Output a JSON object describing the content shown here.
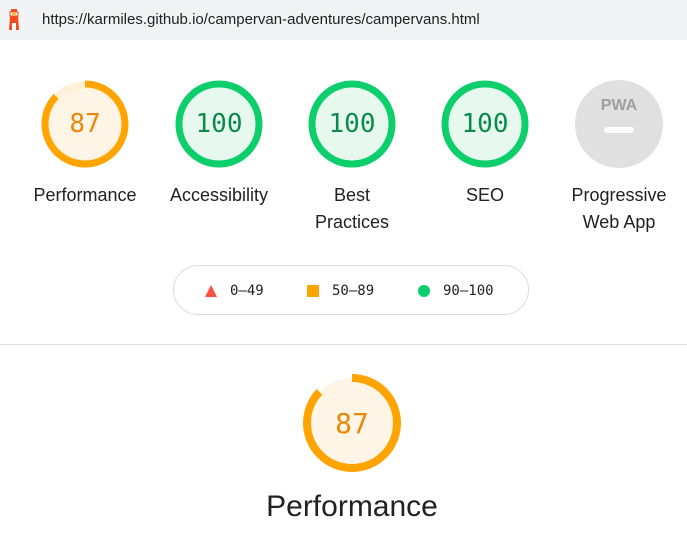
{
  "browser": {
    "url": "https://karmiles.github.io/campervan-adventures/campervans.html",
    "icon": "lighthouse-icon"
  },
  "gauges": [
    {
      "label": "Performance",
      "score": "87",
      "value": 87,
      "status": "average"
    },
    {
      "label": "Accessibility",
      "score": "100",
      "value": 100,
      "status": "pass"
    },
    {
      "label": "Best Practices",
      "score": "100",
      "value": 100,
      "status": "pass"
    },
    {
      "label": "SEO",
      "score": "100",
      "value": 100,
      "status": "pass"
    },
    {
      "label": "Progressive Web App",
      "badge": "PWA",
      "status": "na"
    }
  ],
  "legend": {
    "fail": "0–49",
    "average": "50–89",
    "pass": "90–100"
  },
  "section": {
    "title": "Performance",
    "score": "87",
    "value": 87
  },
  "colors": {
    "pass": "#0cce6b",
    "pass_bg": "#e7f9ef",
    "pass_text": "#0b8a4a",
    "average": "#ffa400",
    "average_bg": "#fff5e6",
    "average_text": "#e8890b",
    "fail": "#ff4e42",
    "na_bg": "#e0e0e0"
  }
}
